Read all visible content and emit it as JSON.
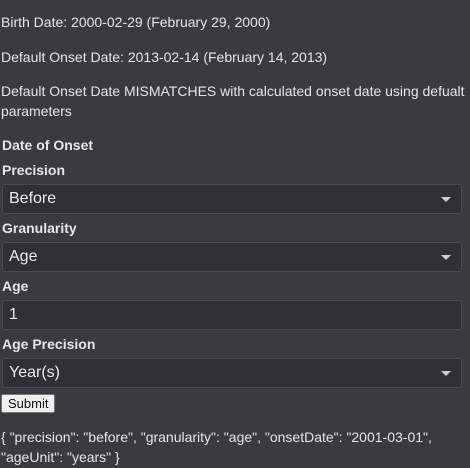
{
  "info": {
    "birth_date": "Birth Date: 2000-02-29 (February 29, 2000)",
    "default_onset": "Default Onset Date: 2013-02-14 (February 14, 2013)",
    "mismatch": "Default Onset Date MISMATCHES with calculated onset date using defualt parameters"
  },
  "form": {
    "section_title": "Date of Onset",
    "precision": {
      "label": "Precision",
      "value": "Before"
    },
    "granularity": {
      "label": "Granularity",
      "value": "Age"
    },
    "age": {
      "label": "Age",
      "value": "1"
    },
    "age_precision": {
      "label": "Age Precision",
      "value": "Year(s)"
    },
    "submit_label": "Submit"
  },
  "output": {
    "json_text": "{ \"precision\": \"before\", \"granularity\": \"age\", \"onsetDate\": \"2001-03-01\", \"ageUnit\": \"years\" }"
  }
}
